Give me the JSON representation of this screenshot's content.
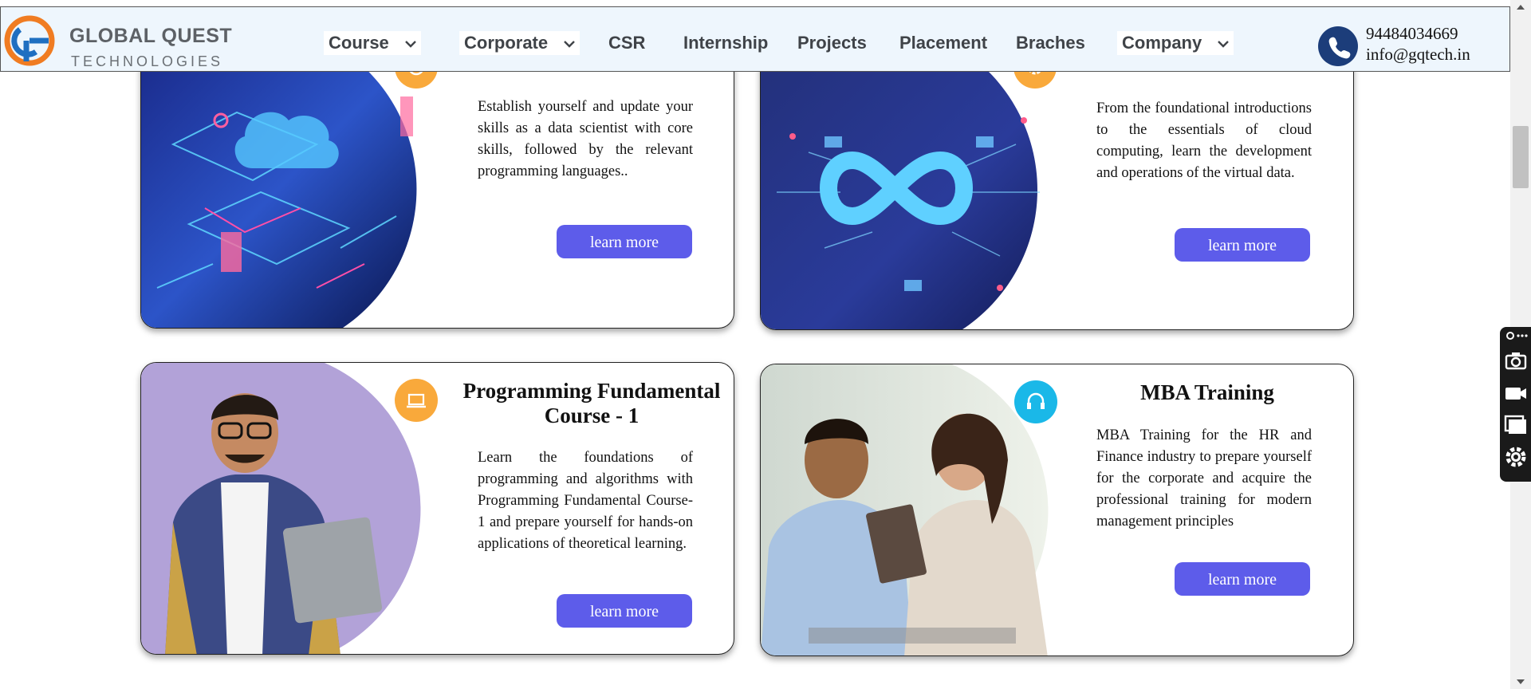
{
  "brand": {
    "name": "GLOBAL QUEST",
    "tagline": "TECHNOLOGIES"
  },
  "nav": {
    "items": [
      {
        "label": "Course",
        "dropdown": true
      },
      {
        "label": "Corporate",
        "dropdown": true
      },
      {
        "label": "CSR",
        "dropdown": false
      },
      {
        "label": "Internship",
        "dropdown": false
      },
      {
        "label": "Projects",
        "dropdown": false
      },
      {
        "label": "Placement",
        "dropdown": false
      },
      {
        "label": "Braches",
        "dropdown": false
      },
      {
        "label": "Company",
        "dropdown": true
      }
    ]
  },
  "contact": {
    "phone": "94484034669",
    "email": "info@gqtech.in",
    "icon": "phone-icon"
  },
  "cards": [
    {
      "title": "",
      "description": "Establish yourself and update your skills as a data scientist with core skills, followed by the relevant programming languages..",
      "button": "learn more",
      "badge_color": "#f9a93b",
      "badge_icon": "gear-brain-icon"
    },
    {
      "title": "",
      "description": "From the foundational introductions to the essentials of cloud computing, learn the development and operations of the virtual data.",
      "button": "learn more",
      "badge_color": "#f9a93b",
      "badge_icon": "gear-icon"
    },
    {
      "title": "Programming Fundamental Course - 1",
      "description": "Learn the foundations of programming and algorithms with Programming Fundamental Course-1 and prepare yourself for hands-on applications of theoretical learning.",
      "button": "learn more",
      "badge_color": "#f9a93b",
      "badge_icon": "laptop-book-icon"
    },
    {
      "title": "MBA Training",
      "description": "MBA Training for the HR and Finance industry to prepare yourself for the corporate and acquire the professional training for modern management principles",
      "button": "learn more",
      "badge_color": "#1ab8e8",
      "badge_icon": "headset-icon"
    }
  ],
  "colors": {
    "header_bg": "#eef6fd",
    "button": "#5d5cea",
    "logo_orange": "#f07c22",
    "logo_blue": "#1f6fc1",
    "phone_icon_bg": "#1c3d7a"
  },
  "side_toolbar": {
    "tools": [
      "screenshot-camera-icon",
      "video-record-icon",
      "windows-icon",
      "settings-gear-icon"
    ]
  }
}
